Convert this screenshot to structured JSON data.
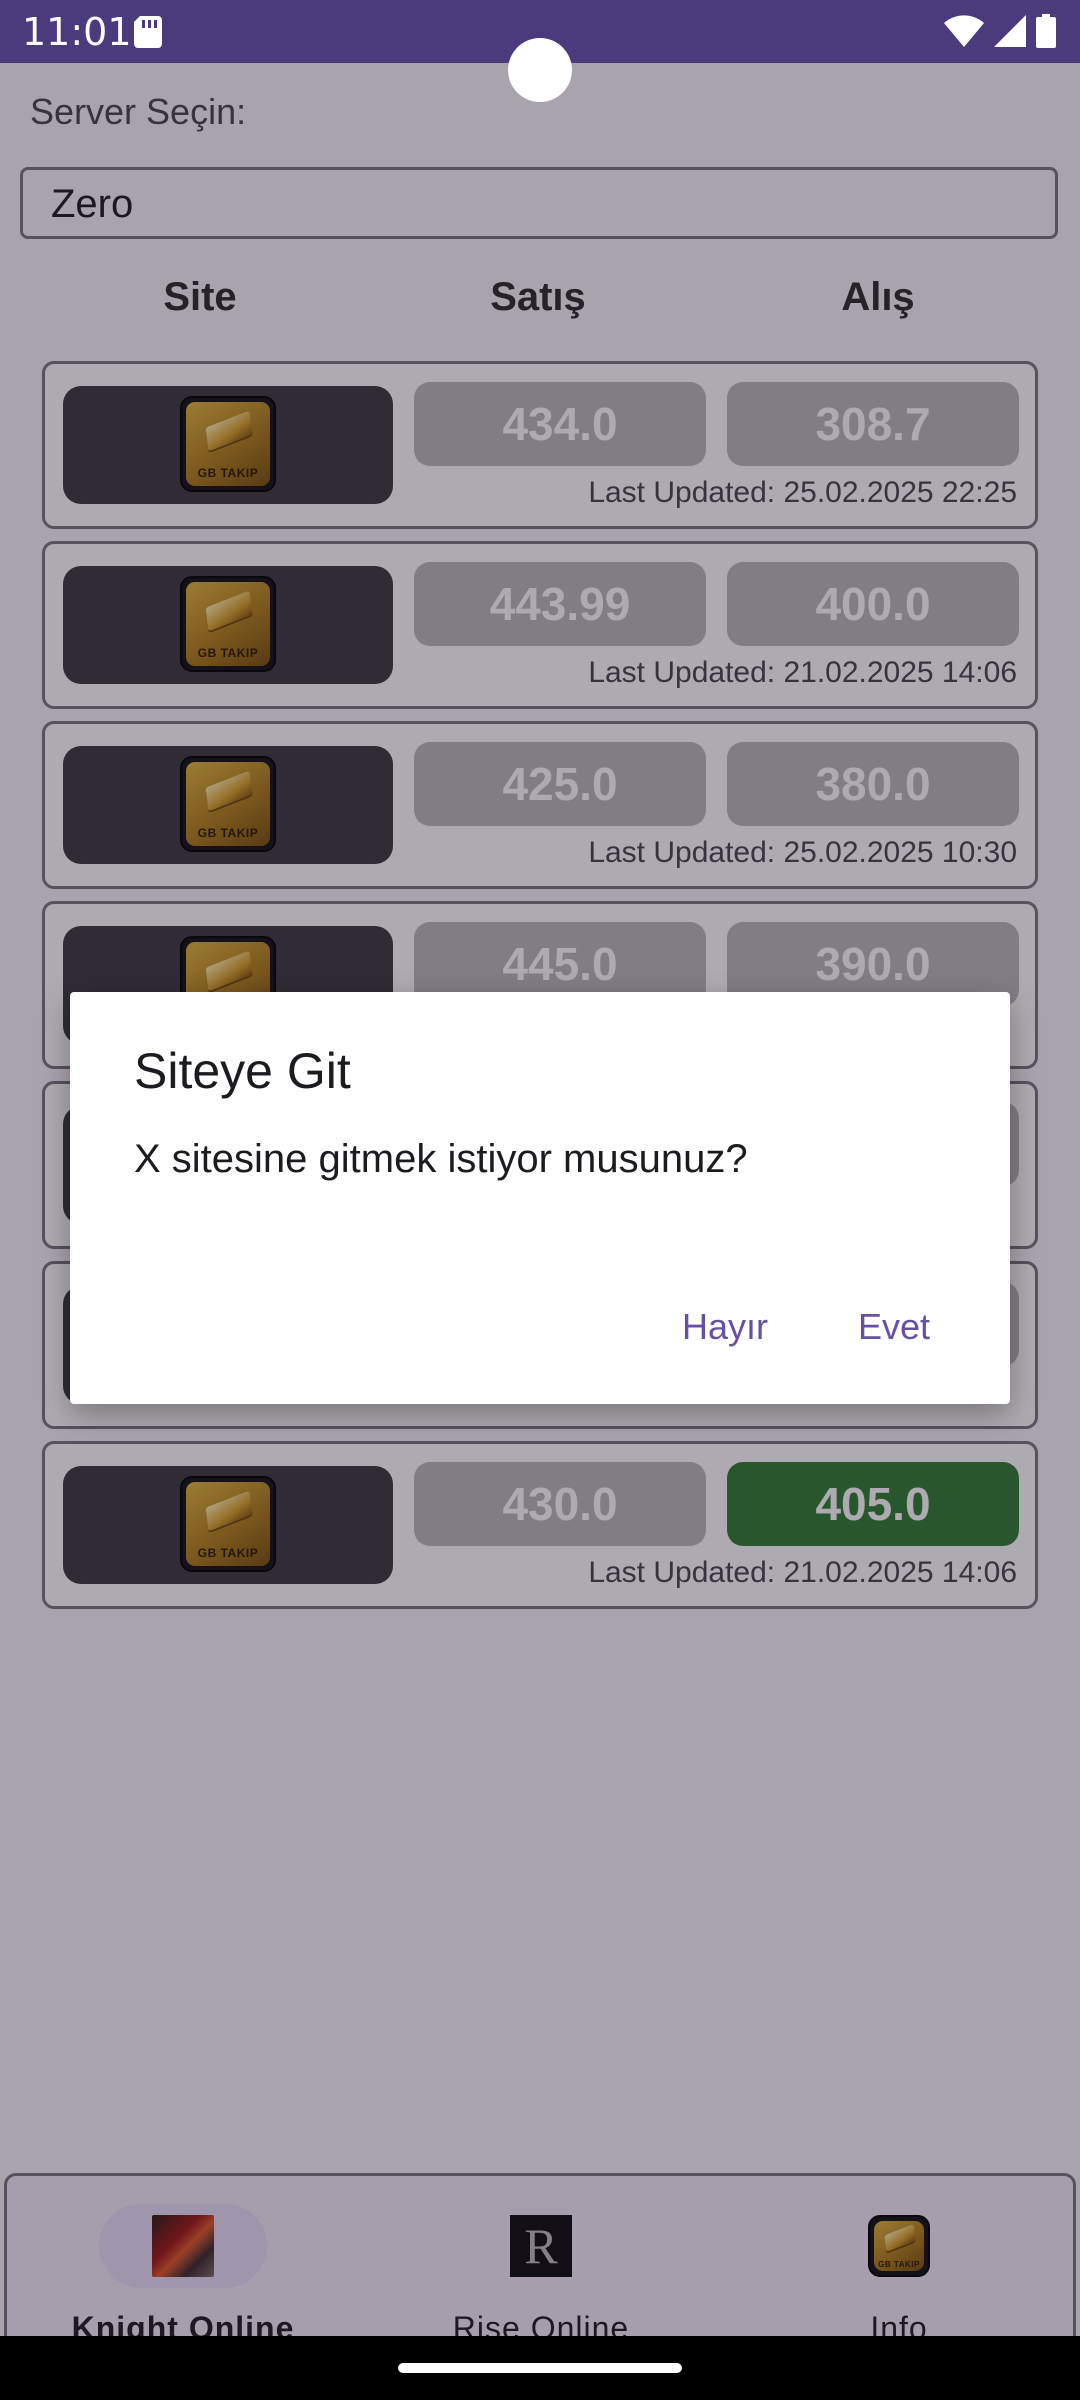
{
  "status_bar": {
    "time": "11:01"
  },
  "app": {
    "server_label": "Server Seçin:",
    "server_value": "Zero",
    "columns": {
      "site": "Site",
      "sale": "Satış",
      "buy": "Alış"
    },
    "logo_text": "GB TAKIP",
    "rows": [
      {
        "sale": "434.0",
        "buy": "308.7",
        "updated": "Last Updated: 25.02.2025 22:25"
      },
      {
        "sale": "443.99",
        "buy": "400.0",
        "updated": "Last Updated: 21.02.2025 14:06"
      },
      {
        "sale": "425.0",
        "buy": "380.0",
        "updated": "Last Updated: 25.02.2025 10:30"
      },
      {
        "sale": "445.0",
        "buy": "390.0",
        "updated": ""
      },
      {
        "sale": "",
        "buy": "",
        "updated": ""
      },
      {
        "sale": "",
        "buy": "",
        "updated": ""
      },
      {
        "sale": "430.0",
        "buy": "405.0",
        "updated": "Last Updated: 21.02.2025 14:06"
      }
    ],
    "highlight_color": "#2e7d32"
  },
  "dialog": {
    "title": "Siteye Git",
    "message": "X sitesine gitmek istiyor musunuz?",
    "no_label": "Hayır",
    "yes_label": "Evet"
  },
  "bottom_nav": {
    "items": [
      {
        "label": "Knight Online",
        "icon": "knight-online-icon",
        "active": true
      },
      {
        "label": "Rise Online",
        "icon": "rise-online-icon",
        "active": false
      },
      {
        "label": "Info",
        "icon": "gb-takip-icon",
        "active": false
      }
    ]
  }
}
